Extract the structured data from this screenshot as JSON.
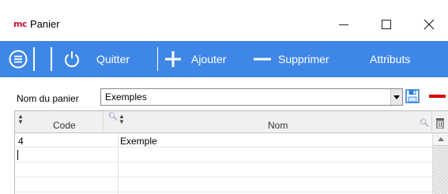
{
  "window": {
    "logo_text": "mc",
    "title": "Panier"
  },
  "toolbar": {
    "quit_label": "Quitter",
    "add_label": "Ajouter",
    "remove_label": "Supprimer",
    "attributes_label": "Attributs",
    "background_color": "#3f87e6"
  },
  "basket": {
    "name_label": "Nom du panier",
    "name_value": "Exemples"
  },
  "grid": {
    "columns": [
      "Code",
      "Nom"
    ],
    "rows": [
      {
        "code": "4",
        "nom": "Exemple"
      }
    ]
  },
  "colors": {
    "accent": "#3f87e6",
    "remove_red": "#d90000",
    "logo_red": "#c8102e"
  }
}
